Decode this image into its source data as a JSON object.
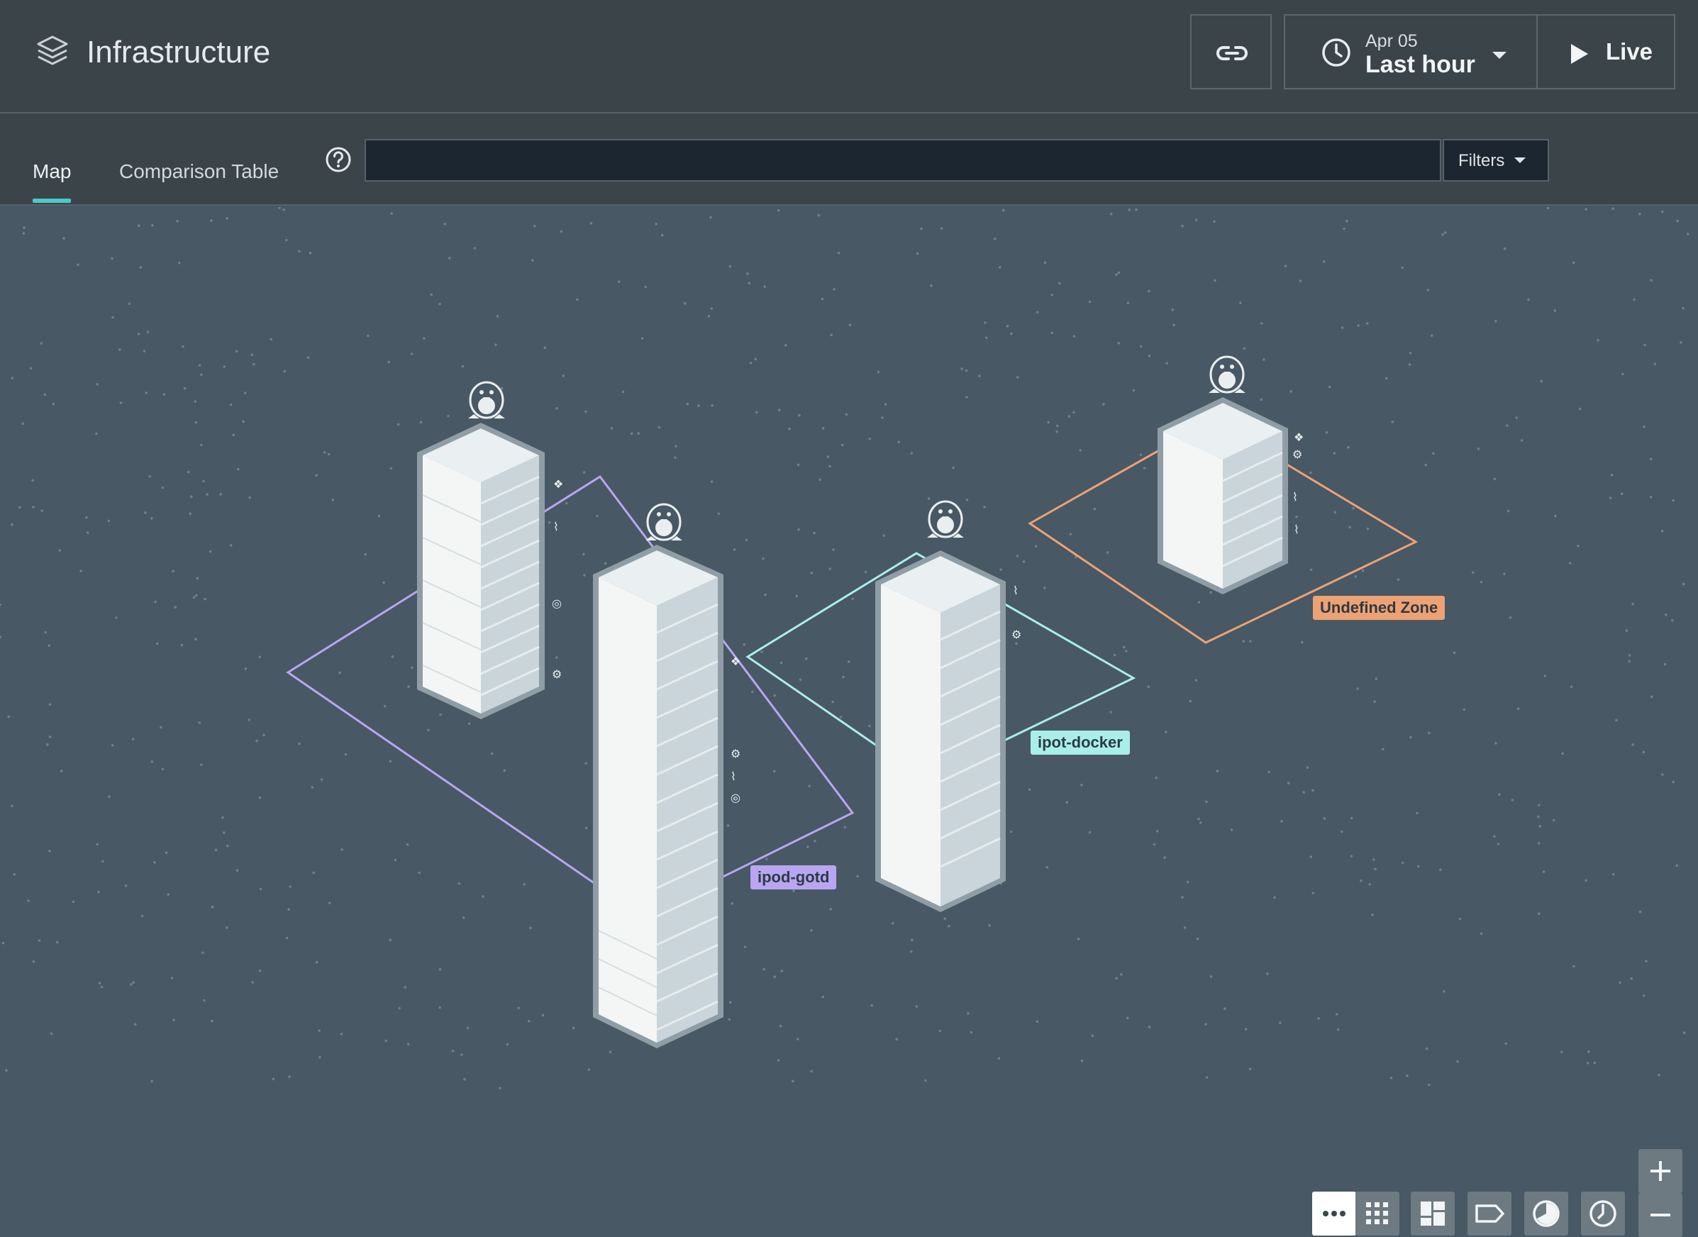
{
  "header": {
    "title": "Infrastructure",
    "app_icon": "layers-icon",
    "link_icon": "link-icon",
    "time": {
      "date": "Apr 05",
      "range": "Last hour",
      "icon": "clock-icon"
    },
    "live_label": "Live"
  },
  "subbar": {
    "tabs": [
      {
        "label": "Map",
        "active": true
      },
      {
        "label": "Comparison Table",
        "active": false
      }
    ],
    "search": {
      "value": "",
      "placeholder": ""
    },
    "filters_label": "Filters"
  },
  "map": {
    "zones": [
      {
        "name": "ipod-gotd",
        "color": "#b9a6f2"
      },
      {
        "name": "ipot-docker",
        "color": "#a9efe9"
      },
      {
        "name": "Undefined Zone",
        "color": "#eda274"
      }
    ],
    "hosts": [
      {
        "zone": "ipod-gotd",
        "os_icon": "linux-penguin-icon"
      },
      {
        "zone": "ipod-gotd",
        "os_icon": "linux-penguin-icon"
      },
      {
        "zone": "ipot-docker",
        "os_icon": "linux-penguin-icon"
      },
      {
        "zone": "Undefined Zone",
        "os_icon": "linux-penguin-icon"
      }
    ]
  },
  "controls": {
    "view_buttons": [
      "more-dots-icon",
      "grid-icon",
      "blocks-icon",
      "tag-icon",
      "pie-icon",
      "clock-icon"
    ],
    "zoom": [
      "zoom-in-icon",
      "zoom-out-icon"
    ]
  },
  "colors": {
    "accent": "#4ec9c9",
    "background": "#485864",
    "header": "#3b4549"
  }
}
